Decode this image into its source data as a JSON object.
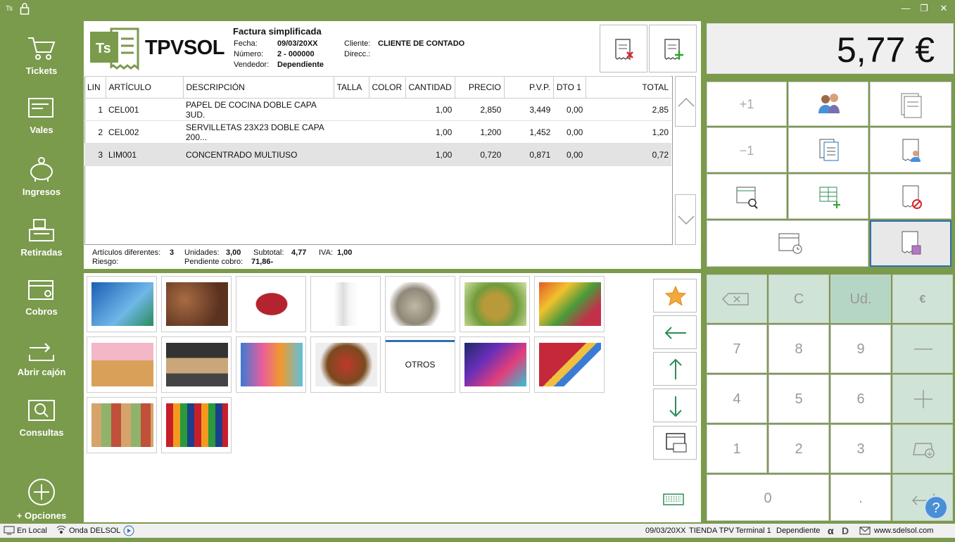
{
  "titlebar": {
    "app_abbr": "Ts"
  },
  "sidebar": {
    "items": [
      {
        "label": "Tickets"
      },
      {
        "label": "Vales"
      },
      {
        "label": "Ingresos"
      },
      {
        "label": "Retiradas"
      },
      {
        "label": "Cobros"
      },
      {
        "label": "Abrir cajón"
      },
      {
        "label": "Consultas"
      },
      {
        "label": "+ Opciones"
      }
    ]
  },
  "header": {
    "brand": "TPVSOL",
    "doc_type": "Factura simplificada",
    "fecha_label": "Fecha:",
    "fecha": "09/03/20XX",
    "numero_label": "Número:",
    "numero": "2 - 000000",
    "vendedor_label": "Vendedor:",
    "vendedor": "Dependiente",
    "cliente_label": "Cliente:",
    "cliente": "CLIENTE DE CONTADO",
    "direcc_label": "Direcc.:"
  },
  "table": {
    "columns": [
      "LIN",
      "ARTÍCULO",
      "DESCRIPCIÓN",
      "TALLA",
      "COLOR",
      "CANTIDAD",
      "PRECIO",
      "P.V.P.",
      "DTO 1",
      "TOTAL"
    ],
    "rows": [
      {
        "lin": "1",
        "art": "CEL001",
        "desc": "PAPEL DE COCINA DOBLE CAPA 3UD.",
        "talla": "",
        "color": "",
        "cant": "1,00",
        "precio": "2,850",
        "pvp": "3,449",
        "dto": "0,00",
        "total": "2,85"
      },
      {
        "lin": "2",
        "art": "CEL002",
        "desc": "SERVILLETAS 23X23 DOBLE CAPA 200...",
        "talla": "",
        "color": "",
        "cant": "1,00",
        "precio": "1,200",
        "pvp": "1,452",
        "dto": "0,00",
        "total": "1,20"
      },
      {
        "lin": "3",
        "art": "LIM001",
        "desc": "CONCENTRADO MULTIUSO",
        "talla": "",
        "color": "",
        "cant": "1,00",
        "precio": "0,720",
        "pvp": "0,871",
        "dto": "0,00",
        "total": "0,72"
      }
    ]
  },
  "summary": {
    "art_dif_label": "Artículos diferentes:",
    "art_dif": "3",
    "unidades_label": "Unidades:",
    "unidades": "3,00",
    "subtotal_label": "Subtotal:",
    "subtotal": "4,77",
    "iva_label": "IVA:",
    "iva": "1,00",
    "riesgo_label": "Riesgo:",
    "pendiente_label": "Pendiente cobro:",
    "pendiente": "71,86-"
  },
  "products": {
    "otros_label": "OTROS"
  },
  "total": {
    "amount": "5,77 €"
  },
  "functions": {
    "plus_one": "+1",
    "minus_one": "−1"
  },
  "keypad": {
    "c": "C",
    "ud": "Ud.",
    "euro": "€",
    "k7": "7",
    "k8": "8",
    "k9": "9",
    "k4": "4",
    "k5": "5",
    "k6": "6",
    "k1": "1",
    "k2": "2",
    "k3": "3",
    "k0": "0",
    "dot": "."
  },
  "status": {
    "local": "En Local",
    "onda": "Onda DELSOL",
    "date": "09/03/20XX",
    "tienda": "TIENDA TPV",
    "terminal": "Terminal 1",
    "user": "Dependiente",
    "web": "www.sdelsol.com"
  },
  "colors": {
    "brand_green": "#7a9a4c",
    "selected_row": "#e3e3e3",
    "keypad_teal": "#cfe3d6"
  }
}
